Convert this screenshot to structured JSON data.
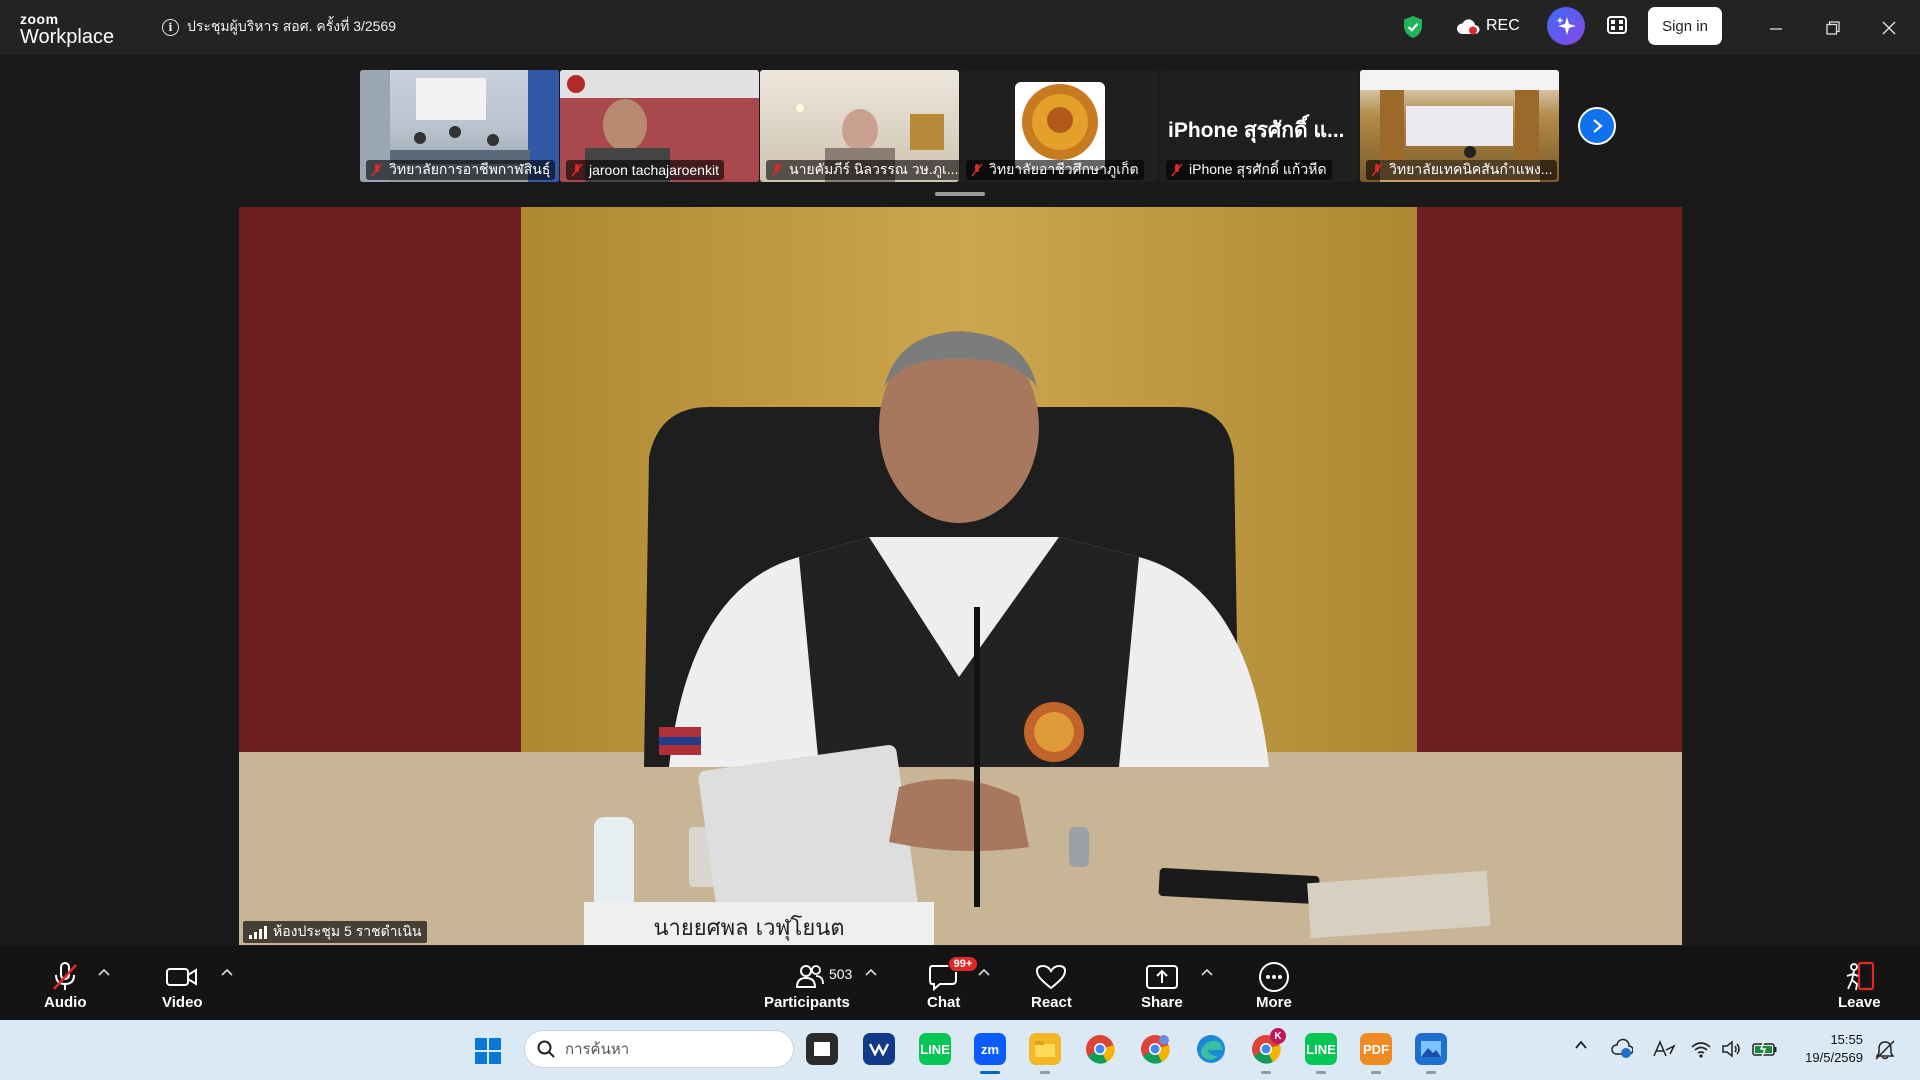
{
  "app": {
    "logo_top": "zoom",
    "logo_bottom": "Workplace"
  },
  "meeting": {
    "title": "ประชุมผู้บริหาร สอศ. ครั้งที่ 3/2569"
  },
  "header": {
    "rec_label": "REC",
    "signin_label": "Sign in"
  },
  "thumbnails": [
    {
      "name": "วิทยาลัยการอาชีพกาฬสินธุ์"
    },
    {
      "name": "jaroon tachajaroenkit"
    },
    {
      "name": "นายคัมภีร์ นิลวรรณ วษ.ภูเ..."
    },
    {
      "name": "วิทยาลัยอาชีวศึกษาภูเก็ต"
    },
    {
      "name": "iPhone สุรศักดิ์ แก้วหีด",
      "display_text": "iPhone สุรศักดิ์ แ..."
    },
    {
      "name": "วิทยาลัยเทคนิคสันกำแพง..."
    }
  ],
  "main_video": {
    "speaker_label": "ห้องประชุม 5 ราชดำเนิน",
    "nameplate": "นายยศพล เวฬุโยนต"
  },
  "toolbar": {
    "audio": "Audio",
    "video": "Video",
    "participants": "Participants",
    "participant_count": "503",
    "chat": "Chat",
    "chat_badge": "99+",
    "react": "React",
    "share": "Share",
    "more": "More",
    "leave": "Leave"
  },
  "taskbar": {
    "search_placeholder": "การค้นหา",
    "time": "15:55",
    "date": "19/5/2569",
    "chrome_badge": "K"
  },
  "colors": {
    "zoom_blue": "#0e72ed",
    "mute_red": "#e02828",
    "taskbar": "#dbe9f4"
  }
}
